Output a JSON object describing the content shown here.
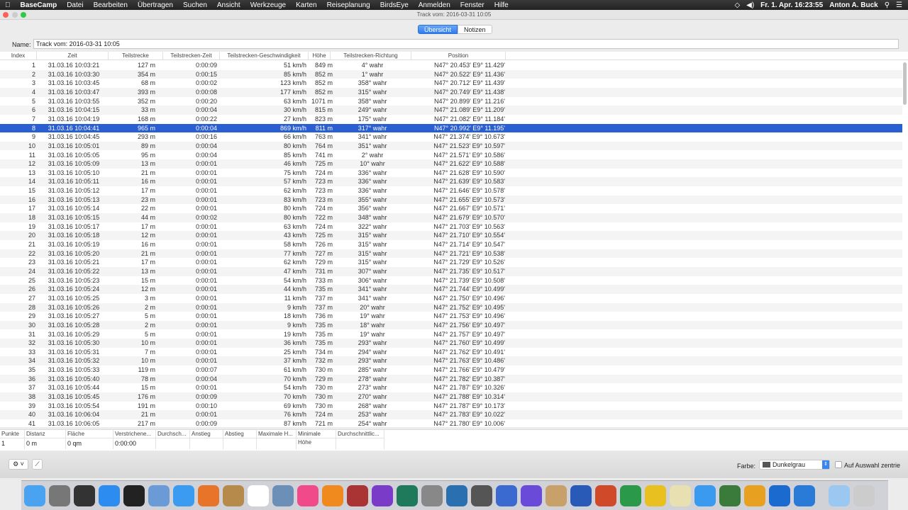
{
  "menubar": {
    "app": "BaseCamp",
    "items": [
      "Datei",
      "Bearbeiten",
      "Übertragen",
      "Suchen",
      "Ansicht",
      "Werkzeuge",
      "Karten",
      "Reiseplanung",
      "BirdsEye",
      "Anmelden",
      "Fenster",
      "Hilfe"
    ],
    "clock": "Fr. 1. Apr.  16:23:55",
    "user": "Anton A. Buck"
  },
  "window": {
    "title": "Track vom: 2016-03-31 10:05"
  },
  "tabs": {
    "overview": "Übersicht",
    "notes": "Notizen"
  },
  "name": {
    "label": "Name:",
    "value": "Track vom: 2016-03-31 10:05"
  },
  "table": {
    "headers": [
      "Index",
      "Zeit",
      "Teilstrecke",
      "Teilstrecken-Zeit",
      "Teilstrecken-Geschwindigkeit",
      "Höhe",
      "Teilstrecken-Richtung",
      "Position"
    ],
    "selected_index": 8,
    "rows": [
      [
        "1",
        "31.03.16 10:03:21",
        "127 m",
        "0:00:09",
        "51 km/h",
        "849 m",
        "4° wahr",
        "N47° 20.453' E9° 11.429'"
      ],
      [
        "2",
        "31.03.16 10:03:30",
        "354 m",
        "0:00:15",
        "85 km/h",
        "852 m",
        "1° wahr",
        "N47° 20.522' E9° 11.436'"
      ],
      [
        "3",
        "31.03.16 10:03:45",
        "68 m",
        "0:00:02",
        "123 km/h",
        "852 m",
        "358° wahr",
        "N47° 20.712' E9° 11.439'"
      ],
      [
        "4",
        "31.03.16 10:03:47",
        "393 m",
        "0:00:08",
        "177 km/h",
        "852 m",
        "315° wahr",
        "N47° 20.749' E9° 11.438'"
      ],
      [
        "5",
        "31.03.16 10:03:55",
        "352 m",
        "0:00:20",
        "63 km/h",
        "1071 m",
        "358° wahr",
        "N47° 20.899' E9° 11.216'"
      ],
      [
        "6",
        "31.03.16 10:04:15",
        "33 m",
        "0:00:04",
        "30 km/h",
        "815 m",
        "249° wahr",
        "N47° 21.089' E9° 11.209'"
      ],
      [
        "7",
        "31.03.16 10:04:19",
        "168 m",
        "0:00:22",
        "27 km/h",
        "823 m",
        "175° wahr",
        "N47° 21.082' E9° 11.184'"
      ],
      [
        "8",
        "31.03.16 10:04:41",
        "965 m",
        "0:00:04",
        "869 km/h",
        "811 m",
        "317° wahr",
        "N47° 20.992' E9° 11.195'"
      ],
      [
        "9",
        "31.03.16 10:04:45",
        "293 m",
        "0:00:16",
        "66 km/h",
        "763 m",
        "341° wahr",
        "N47° 21.374' E9° 10.673'"
      ],
      [
        "10",
        "31.03.16 10:05:01",
        "89 m",
        "0:00:04",
        "80 km/h",
        "764 m",
        "351° wahr",
        "N47° 21.523' E9° 10.597'"
      ],
      [
        "11",
        "31.03.16 10:05:05",
        "95 m",
        "0:00:04",
        "85 km/h",
        "741 m",
        "2° wahr",
        "N47° 21.571' E9° 10.586'"
      ],
      [
        "12",
        "31.03.16 10:05:09",
        "13 m",
        "0:00:01",
        "46 km/h",
        "725 m",
        "10° wahr",
        "N47° 21.622' E9° 10.588'"
      ],
      [
        "13",
        "31.03.16 10:05:10",
        "21 m",
        "0:00:01",
        "75 km/h",
        "724 m",
        "336° wahr",
        "N47° 21.628' E9° 10.590'"
      ],
      [
        "14",
        "31.03.16 10:05:11",
        "16 m",
        "0:00:01",
        "57 km/h",
        "723 m",
        "336° wahr",
        "N47° 21.639' E9° 10.583'"
      ],
      [
        "15",
        "31.03.16 10:05:12",
        "17 m",
        "0:00:01",
        "62 km/h",
        "723 m",
        "336° wahr",
        "N47° 21.646' E9° 10.578'"
      ],
      [
        "16",
        "31.03.16 10:05:13",
        "23 m",
        "0:00:01",
        "83 km/h",
        "723 m",
        "355° wahr",
        "N47° 21.655' E9° 10.573'"
      ],
      [
        "17",
        "31.03.16 10:05:14",
        "22 m",
        "0:00:01",
        "80 km/h",
        "724 m",
        "356° wahr",
        "N47° 21.667' E9° 10.571'"
      ],
      [
        "18",
        "31.03.16 10:05:15",
        "44 m",
        "0:00:02",
        "80 km/h",
        "722 m",
        "348° wahr",
        "N47° 21.679' E9° 10.570'"
      ],
      [
        "19",
        "31.03.16 10:05:17",
        "17 m",
        "0:00:01",
        "63 km/h",
        "724 m",
        "322° wahr",
        "N47° 21.703' E9° 10.563'"
      ],
      [
        "20",
        "31.03.16 10:05:18",
        "12 m",
        "0:00:01",
        "43 km/h",
        "725 m",
        "315° wahr",
        "N47° 21.710' E9° 10.554'"
      ],
      [
        "21",
        "31.03.16 10:05:19",
        "16 m",
        "0:00:01",
        "58 km/h",
        "726 m",
        "315° wahr",
        "N47° 21.714' E9° 10.547'"
      ],
      [
        "22",
        "31.03.16 10:05:20",
        "21 m",
        "0:00:01",
        "77 km/h",
        "727 m",
        "315° wahr",
        "N47° 21.721' E9° 10.538'"
      ],
      [
        "23",
        "31.03.16 10:05:21",
        "17 m",
        "0:00:01",
        "62 km/h",
        "729 m",
        "315° wahr",
        "N47° 21.729' E9° 10.526'"
      ],
      [
        "24",
        "31.03.16 10:05:22",
        "13 m",
        "0:00:01",
        "47 km/h",
        "731 m",
        "307° wahr",
        "N47° 21.735' E9° 10.517'"
      ],
      [
        "25",
        "31.03.16 10:05:23",
        "15 m",
        "0:00:01",
        "54 km/h",
        "733 m",
        "306° wahr",
        "N47° 21.739' E9° 10.508'"
      ],
      [
        "26",
        "31.03.16 10:05:24",
        "12 m",
        "0:00:01",
        "44 km/h",
        "735 m",
        "341° wahr",
        "N47° 21.744' E9° 10.499'"
      ],
      [
        "27",
        "31.03.16 10:05:25",
        "3 m",
        "0:00:01",
        "11 km/h",
        "737 m",
        "341° wahr",
        "N47° 21.750' E9° 10.496'"
      ],
      [
        "28",
        "31.03.16 10:05:26",
        "2 m",
        "0:00:01",
        "9 km/h",
        "737 m",
        "20° wahr",
        "N47° 21.752' E9° 10.495'"
      ],
      [
        "29",
        "31.03.16 10:05:27",
        "5 m",
        "0:00:01",
        "18 km/h",
        "736 m",
        "19° wahr",
        "N47° 21.753' E9° 10.496'"
      ],
      [
        "30",
        "31.03.16 10:05:28",
        "2 m",
        "0:00:01",
        "9 km/h",
        "735 m",
        "18° wahr",
        "N47° 21.756' E9° 10.497'"
      ],
      [
        "31",
        "31.03.16 10:05:29",
        "5 m",
        "0:00:01",
        "19 km/h",
        "735 m",
        "19° wahr",
        "N47° 21.757' E9° 10.497'"
      ],
      [
        "32",
        "31.03.16 10:05:30",
        "10 m",
        "0:00:01",
        "36 km/h",
        "735 m",
        "293° wahr",
        "N47° 21.760' E9° 10.499'"
      ],
      [
        "33",
        "31.03.16 10:05:31",
        "7 m",
        "0:00:01",
        "25 km/h",
        "734 m",
        "294° wahr",
        "N47° 21.762' E9° 10.491'"
      ],
      [
        "34",
        "31.03.16 10:05:32",
        "10 m",
        "0:00:01",
        "37 km/h",
        "732 m",
        "293° wahr",
        "N47° 21.763' E9° 10.486'"
      ],
      [
        "35",
        "31.03.16 10:05:33",
        "119 m",
        "0:00:07",
        "61 km/h",
        "730 m",
        "285° wahr",
        "N47° 21.766' E9° 10.479'"
      ],
      [
        "36",
        "31.03.16 10:05:40",
        "78 m",
        "0:00:04",
        "70 km/h",
        "729 m",
        "278° wahr",
        "N47° 21.782' E9° 10.387'"
      ],
      [
        "37",
        "31.03.16 10:05:44",
        "15 m",
        "0:00:01",
        "54 km/h",
        "730 m",
        "273° wahr",
        "N47° 21.787' E9° 10.326'"
      ],
      [
        "38",
        "31.03.16 10:05:45",
        "176 m",
        "0:00:09",
        "70 km/h",
        "730 m",
        "270° wahr",
        "N47° 21.788' E9° 10.314'"
      ],
      [
        "39",
        "31.03.16 10:05:54",
        "191 m",
        "0:00:10",
        "69 km/h",
        "730 m",
        "268° wahr",
        "N47° 21.787' E9° 10.173'"
      ],
      [
        "40",
        "31.03.16 10:06:04",
        "21 m",
        "0:00:01",
        "76 km/h",
        "724 m",
        "253° wahr",
        "N47° 21.783' E9° 10.022'"
      ],
      [
        "41",
        "31.03.16 10:06:05",
        "217 m",
        "0:00:09",
        "87 km/h",
        "721 m",
        "254° wahr",
        "N47° 21.780' E9° 10.006'"
      ]
    ]
  },
  "stats": {
    "headers": [
      "Punkte",
      "Distanz",
      "Fläche",
      "Verstrichene...",
      "Durchsch...",
      "Anstieg",
      "Abstieg",
      "Maximale H...",
      "Minimale Höhe",
      "Durchschnittlic..."
    ],
    "values": [
      "1",
      "0 m",
      "0 qm",
      "0:00:00",
      "",
      "",
      "",
      "",
      "",
      ""
    ]
  },
  "bottom": {
    "color_label": "Farbe:",
    "color_value": "Dunkelgrau",
    "color_swatch": "#555555",
    "center_label": "Auf Auswahl zentrie"
  },
  "colors": {
    "selection": "#2a5fd2",
    "accent": "#2f7cf0"
  }
}
